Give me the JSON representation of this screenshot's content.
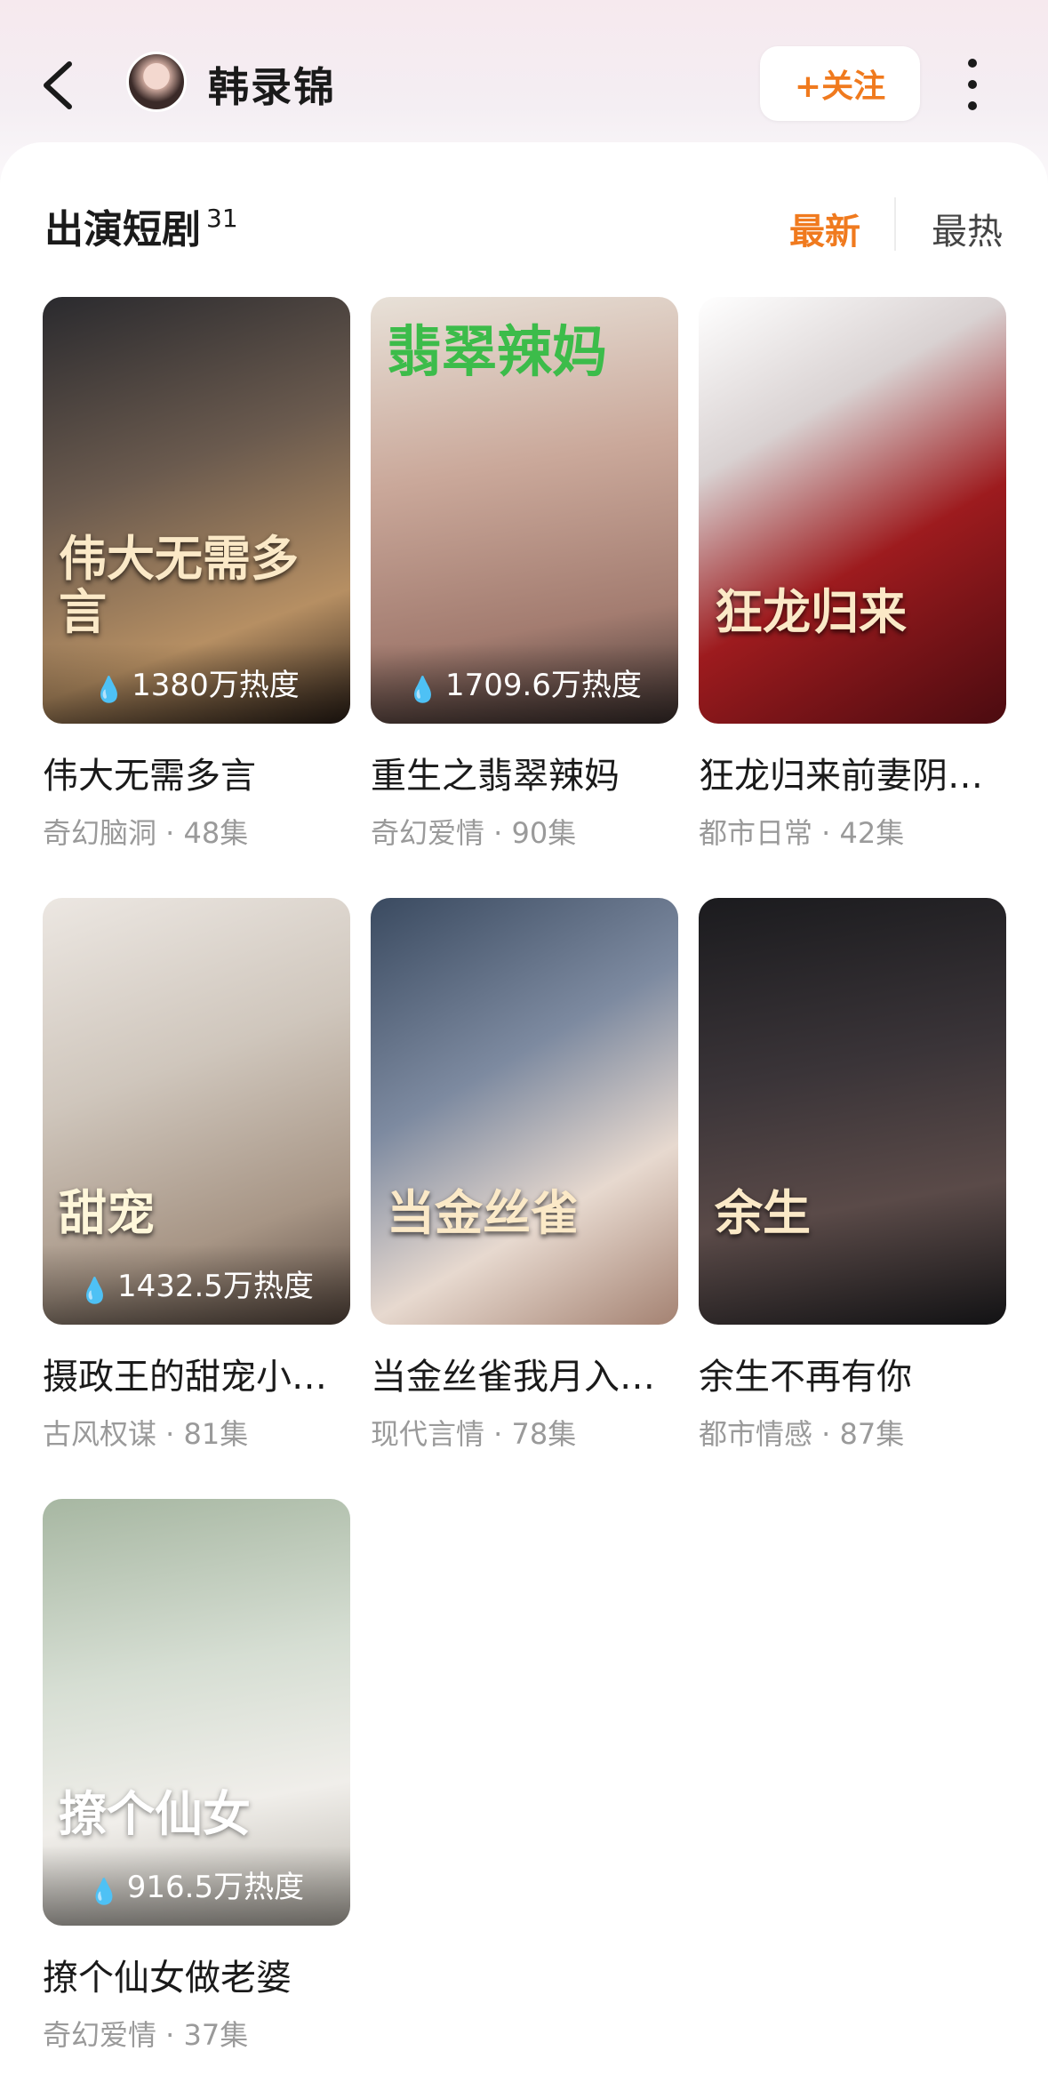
{
  "header": {
    "back_icon": "chevron-left-icon",
    "name": "韩录锦",
    "follow_label": "+关注",
    "more_icon": "more-vertical-icon"
  },
  "section": {
    "title": "出演短剧",
    "count": "31",
    "sort_new": "最新",
    "sort_hot": "最热"
  },
  "accent_color": "#f07a1e",
  "dramas": [
    {
      "title": "伟大无需多言",
      "meta": "奇幻脑洞 · 48集",
      "heat": "1380万热度",
      "poster_text": "伟大无需多言"
    },
    {
      "title": "重生之翡翠辣妈",
      "meta": "奇幻爱情 · 90集",
      "heat": "1709.6万热度",
      "poster_text": "翡翠辣妈"
    },
    {
      "title": "狂龙归来前妻阴…",
      "meta": "都市日常 · 42集",
      "heat": "",
      "poster_text": "狂龙归来"
    },
    {
      "title": "摄政王的甜宠小…",
      "meta": "古风权谋 · 81集",
      "heat": "1432.5万热度",
      "poster_text": "甜宠"
    },
    {
      "title": "当金丝雀我月入…",
      "meta": "现代言情 · 78集",
      "heat": "",
      "poster_text": "当金丝雀"
    },
    {
      "title": "余生不再有你",
      "meta": "都市情感 · 87集",
      "heat": "",
      "poster_text": "余生"
    },
    {
      "title": "撩个仙女做老婆",
      "meta": "奇幻爱情 · 37集",
      "heat": "916.5万热度",
      "poster_text": "撩个仙女"
    }
  ]
}
